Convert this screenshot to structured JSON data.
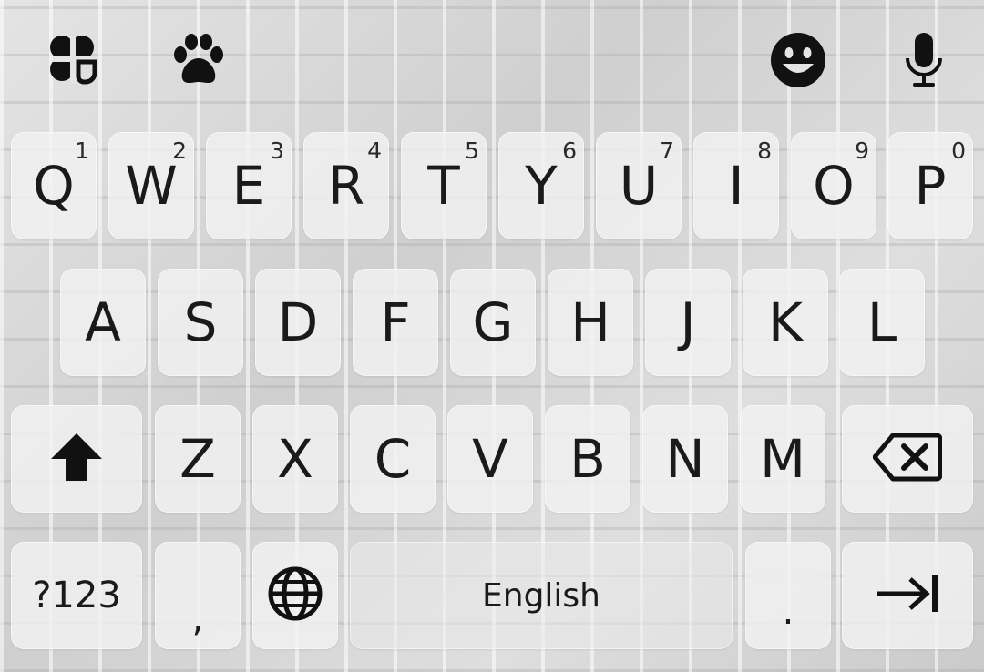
{
  "toolbar": {
    "icons": [
      "clover-cup-icon",
      "paw-icon",
      "emoji-icon",
      "microphone-icon"
    ]
  },
  "rows": {
    "row1": [
      {
        "label": "Q",
        "hint": "1"
      },
      {
        "label": "W",
        "hint": "2"
      },
      {
        "label": "E",
        "hint": "3"
      },
      {
        "label": "R",
        "hint": "4"
      },
      {
        "label": "T",
        "hint": "5"
      },
      {
        "label": "Y",
        "hint": "6"
      },
      {
        "label": "U",
        "hint": "7"
      },
      {
        "label": "I",
        "hint": "8"
      },
      {
        "label": "O",
        "hint": "9"
      },
      {
        "label": "P",
        "hint": "0"
      }
    ],
    "row2": [
      {
        "label": "A"
      },
      {
        "label": "S"
      },
      {
        "label": "D"
      },
      {
        "label": "F"
      },
      {
        "label": "G"
      },
      {
        "label": "H"
      },
      {
        "label": "J"
      },
      {
        "label": "K"
      },
      {
        "label": "L"
      }
    ],
    "row3": [
      {
        "label": "Z"
      },
      {
        "label": "X"
      },
      {
        "label": "C"
      },
      {
        "label": "V"
      },
      {
        "label": "B"
      },
      {
        "label": "N"
      },
      {
        "label": "M"
      }
    ]
  },
  "bottom": {
    "symbols_label": "?123",
    "comma_label": ",",
    "space_label": "English",
    "period_label": "."
  }
}
